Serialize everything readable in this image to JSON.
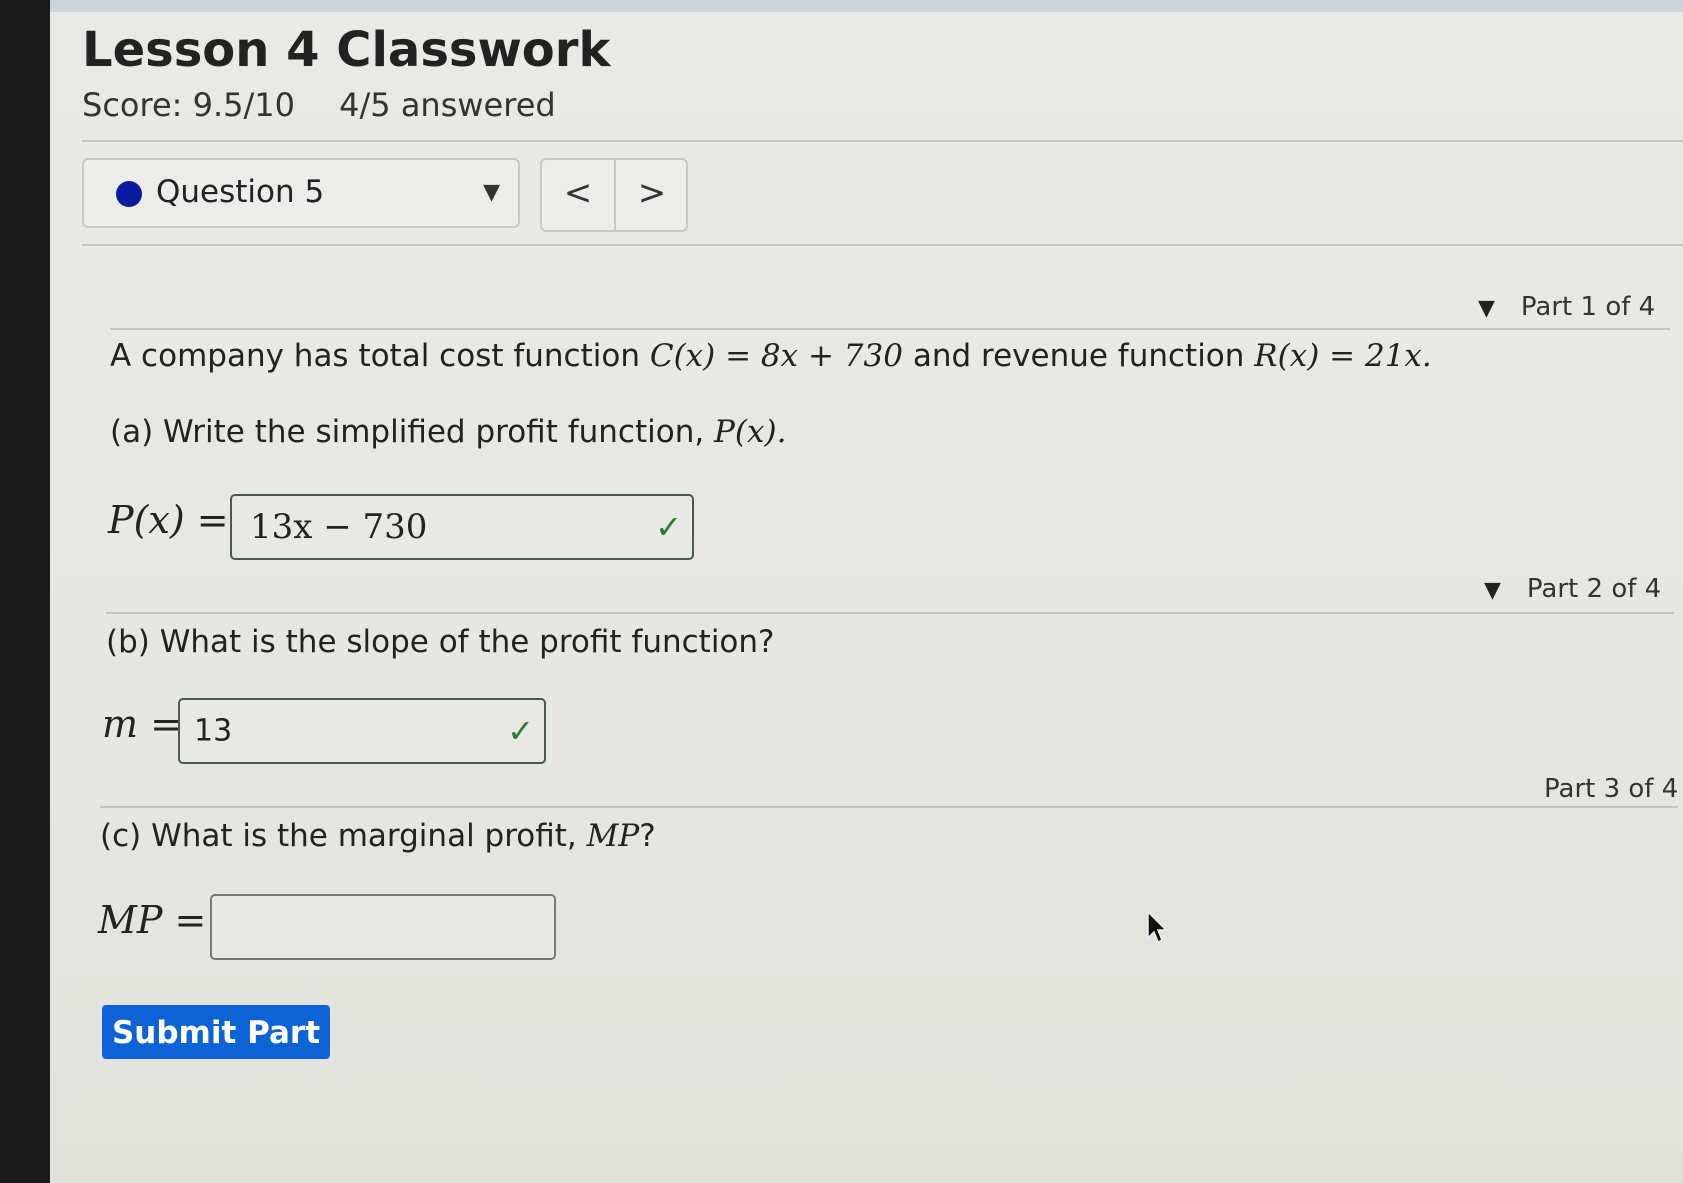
{
  "header": {
    "title": "Lesson 4 Classwork",
    "score": "Score: 9.5/10",
    "answered": "4/5 answered"
  },
  "question_nav": {
    "question_label": "Question 5",
    "prev_glyph": "<",
    "next_glyph": ">"
  },
  "parts": [
    {
      "label": "Part 1 of 4"
    },
    {
      "label": "Part 2 of 4"
    },
    {
      "label": "Part 3 of 4"
    }
  ],
  "problem": {
    "intro_text_1": "A company has total cost function ",
    "cost_function": "C(x) = 8x + 730",
    "intro_text_2": " and revenue function ",
    "revenue_function": "R(x) = 21x.",
    "part_a_prompt": "(a) Write the simplified profit function, ",
    "part_a_math": "P(x).",
    "part_a_label": "P(x) =",
    "part_a_value": "13x − 730",
    "part_b_prompt": "(b) What is the slope of the profit function?",
    "part_b_label": "m =",
    "part_b_value": "13",
    "part_c_prompt": "(c) What is the marginal profit, ",
    "part_c_math": "MP",
    "part_c_q": "?",
    "part_c_label": "MP =",
    "part_c_value": ""
  },
  "submit_label": "Submit Part",
  "check_glyph": "✓",
  "colors": {
    "accent": "#0d63d6",
    "question_dot": "#0b1a9e",
    "correct": "#2f7a2f"
  }
}
